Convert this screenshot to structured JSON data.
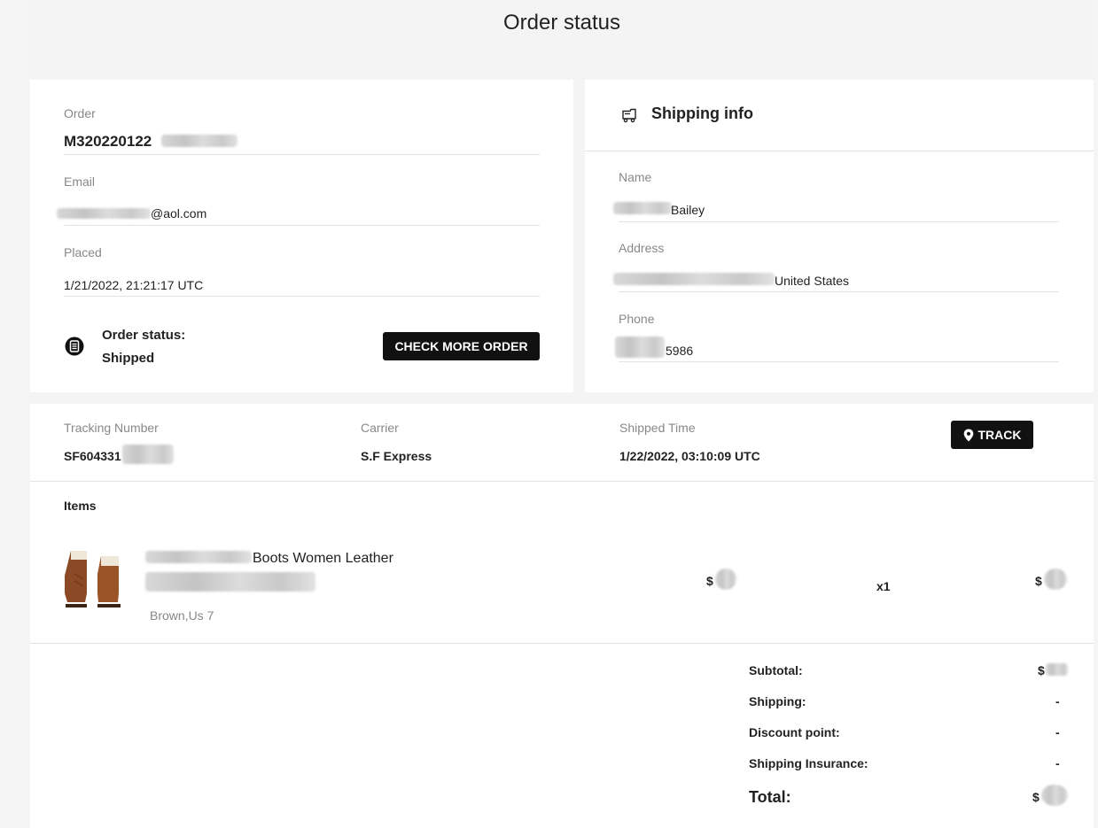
{
  "page": {
    "title": "Order status"
  },
  "order": {
    "order_label": "Order",
    "order_number": "M320220122",
    "email_label": "Email",
    "email": "@aol.com",
    "placed_label": "Placed",
    "placed": "1/21/2022, 21:21:17 UTC",
    "status_label": "Order status:",
    "status_value": "Shipped",
    "check_more_button": "CHECK MORE ORDER"
  },
  "shipping_info": {
    "header": "Shipping info",
    "name_label": "Name",
    "name": "Bailey",
    "address_label": "Address",
    "address": "United States",
    "phone_label": "Phone",
    "phone": "5986"
  },
  "tracking": {
    "tracking_number_label": "Tracking Number",
    "tracking_number": "SF604331",
    "carrier_label": "Carrier",
    "carrier": "S.F Express",
    "shipped_time_label": "Shipped Time",
    "shipped_time": "1/22/2022, 03:10:09 UTC",
    "track_button": "TRACK"
  },
  "items": {
    "header": "Items",
    "list": [
      {
        "title": "Boots Women Leather",
        "variant": "Brown,Us 7",
        "price": "$",
        "quantity": "x1",
        "total": "$"
      }
    ]
  },
  "summary": {
    "subtotal_label": "Subtotal:",
    "subtotal": "$",
    "shipping_label": "Shipping:",
    "shipping": "-",
    "discount_label": "Discount point:",
    "discount": "-",
    "insurance_label": "Shipping Insurance:",
    "insurance": "-",
    "total_label": "Total:",
    "total": "$"
  },
  "colors": {
    "button_bg": "#111111",
    "page_bg": "#f4f4f4",
    "label_gray": "#888888"
  },
  "icons": [
    "order-status-icon",
    "truck-icon",
    "location-pin-icon",
    "boots-product-image"
  ]
}
